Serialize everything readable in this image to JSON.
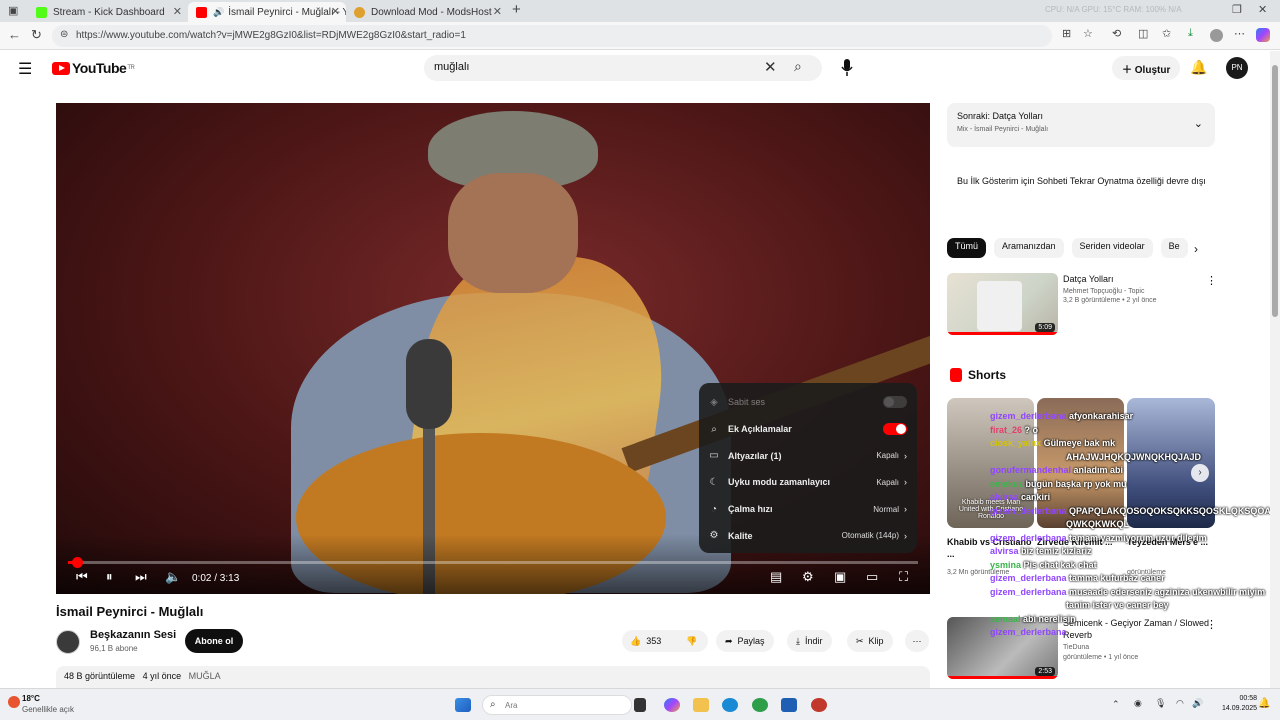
{
  "browser": {
    "tabs": [
      {
        "title": "Stream - Kick Dashboard",
        "icon": "kick-icon",
        "color": "#53fc18"
      },
      {
        "title": "İsmail Peynirci - Muğlalı - Yo",
        "icon": "youtube-icon",
        "color": "#ff0000"
      },
      {
        "title": "Download Mod - ModsHost",
        "icon": "modshost-icon",
        "color": "#e0a030"
      }
    ],
    "new_tab": "+",
    "url": "https://www.youtube.com/watch?v=jMWE2g8GzI0&list=RDjMWE2g8GzI0&start_radio=1",
    "status_readout": "CPU: N/A   GPU: 15°C   RAM: 100%   N/A"
  },
  "youtube": {
    "logo_text": "YouTube",
    "region": "TR",
    "search_value": "muğlalı",
    "create_label": "Oluştur",
    "avatar_initials": "PN"
  },
  "video": {
    "time": "0:02 / 3:13",
    "progress_fraction": 0.01,
    "settings_menu": [
      {
        "label": "Sabit ses",
        "value": "",
        "type": "toggle",
        "on": false,
        "icon": "stable-volume-icon",
        "dim": true
      },
      {
        "label": "Ek Açıklamalar",
        "value": "",
        "type": "toggle",
        "on": true,
        "icon": "annotations-icon",
        "dim": false
      },
      {
        "label": "Altyazılar (1)",
        "value": "Kapalı",
        "type": "submenu",
        "icon": "subtitles-icon"
      },
      {
        "label": "Uyku modu zamanlayıcı",
        "value": "Kapalı",
        "type": "submenu",
        "icon": "sleep-timer-icon"
      },
      {
        "label": "Çalma hızı",
        "value": "Normal",
        "type": "submenu",
        "icon": "playback-speed-icon"
      },
      {
        "label": "Kalite",
        "value": "Otomatik (144p)",
        "type": "submenu",
        "icon": "quality-icon"
      }
    ],
    "title": "İsmail Peynirci - Muğlalı",
    "channel": "Beşkazanın Sesi",
    "subscribers": "96,1 B abone",
    "subscribe_label": "Abone ol",
    "likes": "353",
    "share_label": "Paylaş",
    "download_label": "İndir",
    "clip_label": "Klip",
    "views": "48 B görüntüleme",
    "age": "4 yıl önce",
    "tag": "MUĞLA"
  },
  "sidebar": {
    "next_label": "Sonraki: Datça Yolları",
    "mix_label": "Mix - İsmail Peynirci - Muğlalı",
    "notice": "Bu İlk Gösterim için Sohbeti Tekrar Oynatma özelliği devre dışı",
    "chips": [
      "Tümü",
      "Aramanızdan",
      "Seriden videolar",
      "Be"
    ],
    "rec1": {
      "title": "Datça Yolları",
      "channel": "Mehmet Topçuoğlu - Topic",
      "meta": "3,2 B görüntüleme • 2 yıl önce",
      "duration": "5:09"
    },
    "shorts_header": "Shorts",
    "shorts": [
      {
        "title": "Khabib vs Cristiano ...",
        "meta": "3,2 Mn görüntüleme",
        "thumb_text": "Khabib meets Man United with Cristiano Ronaldo"
      },
      {
        "title": "Zirvede Kıremit ...",
        "meta": "",
        "thumb_text": ""
      },
      {
        "title": "Teyzeden Mers'e ...",
        "meta": "görüntüleme",
        "thumb_text": ""
      }
    ],
    "rec2": {
      "title": "Semicenk - Geçiyor Zaman / Slowed Reverb",
      "channel": "TieDuna",
      "meta": "görüntüleme • 1 yıl önce",
      "duration": "2:53"
    }
  },
  "chat": [
    {
      "user": "gizem_derlerbana",
      "text": "afyonkarahisar"
    },
    {
      "user": "firat_26",
      "text": "? o"
    },
    {
      "user": "ciosk_yalnx",
      "text": "Gülmeye bak mk"
    },
    {
      "user": "",
      "text": "AHAJWJHQKQJWNQKHQJAJD"
    },
    {
      "user": "gonufermandenhal",
      "text": "anladım abi"
    },
    {
      "user": "emekuz",
      "text": "bugün başka rp yok mu"
    },
    {
      "user": "alvirsa",
      "text": "cankiri"
    },
    {
      "user": "gizem_derlerbana",
      "text": "QPAPQLAKQOSOQOKSQKKSQOSKLQKSQOAK"
    },
    {
      "user": "",
      "text": "QWKQKWKQL"
    },
    {
      "user": "gizem_derlerbana",
      "text": "tamam yazmiyorum uzur dilerim"
    },
    {
      "user": "alvirsa",
      "text": "biz temiz kizlariz"
    },
    {
      "user": "ysmina",
      "text": "Pis chat kak chat"
    },
    {
      "user": "gizem_derlerbana",
      "text": "tamma kufurbaz caner"
    },
    {
      "user": "gizem_derlerbana",
      "text": "musaade ederseniz agziniza ukenwbilir miyim"
    },
    {
      "user": "",
      "text": "tanim ister ve caner bey"
    },
    {
      "user": "semaal",
      "text": "abi nerelisin"
    },
    {
      "user": "gizem_derlerbana",
      "text": ""
    }
  ],
  "taskbar": {
    "temperature": "18°C",
    "weather": "Genellikle açık",
    "search_placeholder": "Ara",
    "time": "00:58",
    "date": "14.09.2025"
  }
}
